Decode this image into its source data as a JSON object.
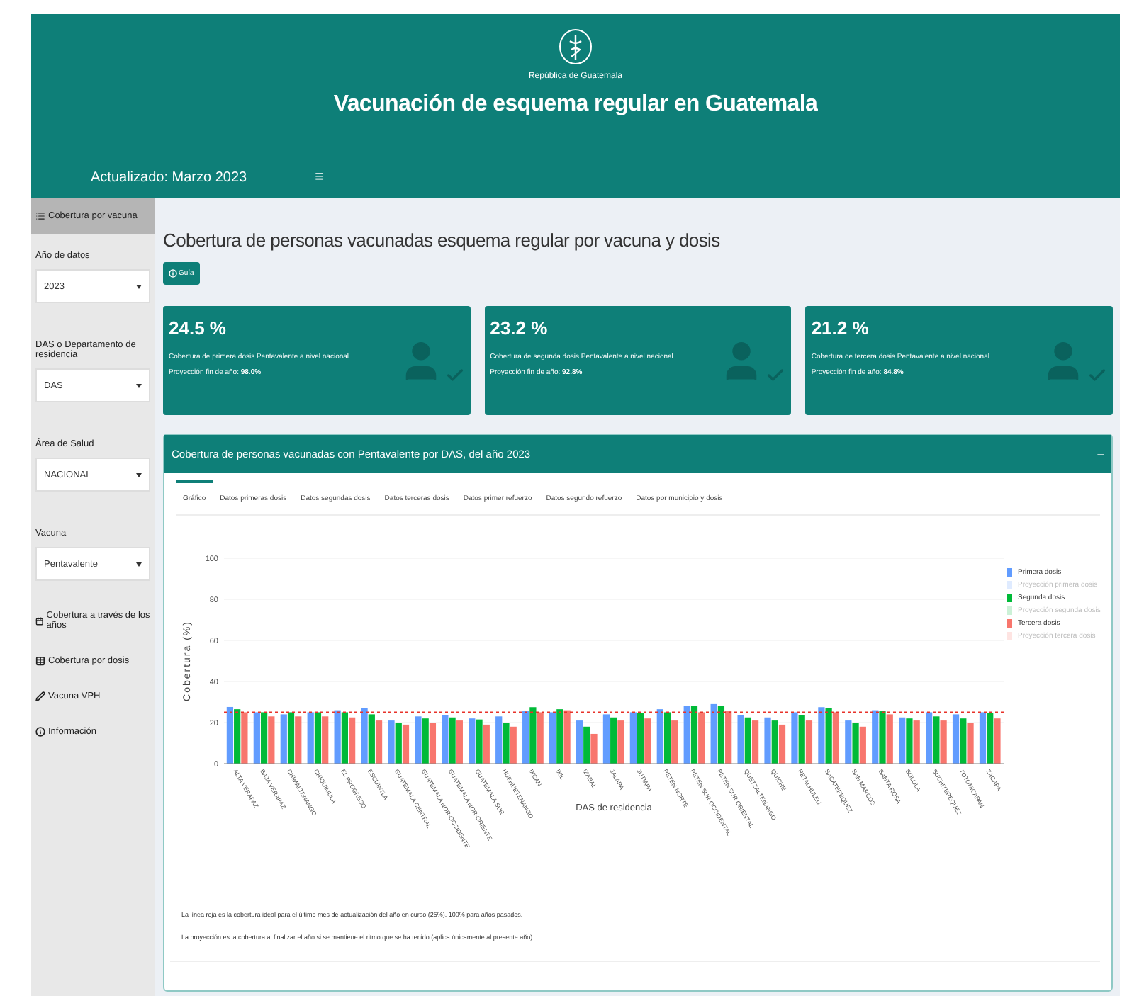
{
  "header": {
    "title": "Vacunación de esquema regular en Guatemala",
    "logo_caption": "República de Guatemala",
    "updated": "Actualizado: Marzo 2023",
    "menu_toggle": "≡"
  },
  "sidebar": {
    "items": [
      {
        "label": "Cobertura por vacuna",
        "selected": true
      }
    ],
    "filters": [
      {
        "label": "Año de datos",
        "value": "2023"
      },
      {
        "label": "DAS o Departamento de residencia",
        "value": "DAS"
      },
      {
        "label": "Área de Salud",
        "value": "NACIONAL"
      },
      {
        "label": "Vacuna",
        "value": "Pentavalente"
      }
    ],
    "links": [
      {
        "label": "Cobertura a través de los años",
        "selected": false
      },
      {
        "label": "Cobertura por dosis",
        "selected": false
      },
      {
        "label": "Vacuna VPH",
        "selected": false
      },
      {
        "label": "Información",
        "selected": false
      }
    ]
  },
  "main": {
    "title": "Cobertura de personas vacunadas esquema regular por vacuna y dosis",
    "guide_button": "Guía",
    "cards": [
      {
        "value": "24.5 %",
        "description": "Cobertura de primera dosis Pentavalente a nivel nacional",
        "projection": "Proyección fin de año: **98.0%**"
      },
      {
        "value": "23.2 %",
        "description": "Cobertura de segunda dosis Pentavalente a nivel nacional",
        "projection": "Proyección fin de año: **92.8%**"
      },
      {
        "value": "21.2 %",
        "description": "Cobertura de tercera dosis Pentavalente a nivel nacional",
        "projection": "Proyección fin de año: **84.8%**"
      }
    ],
    "panel": {
      "title": "Cobertura de personas vacunadas con Pentavalente por DAS, del año 2023",
      "collapse": "−",
      "tabs": [
        {
          "label": "Gráfico",
          "selected": true
        },
        {
          "label": "Datos primeras dosis",
          "selected": false
        },
        {
          "label": "Datos segundas dosis",
          "selected": false
        },
        {
          "label": "Datos terceras dosis",
          "selected": false
        },
        {
          "label": "Datos primer refuerzo",
          "selected": false
        },
        {
          "label": "Datos segundo refuerzo",
          "selected": false
        },
        {
          "label": "Datos por municipio y dosis",
          "selected": false
        }
      ],
      "chart_data": {
        "type": "bar",
        "xlabel": "DAS de residencia",
        "ylabel": "Cobertura (%)",
        "categories": [
          "ALTA VERAPAZ",
          "BAJA VERAPAZ",
          "CHIMALTENANGO",
          "CHIQUIMULA",
          "EL PROGRESO",
          "ESCUINTLA",
          "GUATEMALA CENTRAL",
          "GUATEMALA NOR-OCCIDENTE",
          "GUATEMALA NOR-ORIENTE",
          "GUATEMALA SUR",
          "HUEHUETENANGO",
          "IXCAN",
          "IXIL",
          "IZABAL",
          "JALAPA",
          "JUTIAPA",
          "PETEN NORTE",
          "PETEN SUR OCCIDENTAL",
          "PETEN SUR ORIENTAL",
          "QUETZALTENANGO",
          "QUICHE",
          "RETALHULEU",
          "SACATEPEQUEZ",
          "SAN MARCOS",
          "SANTA ROSA",
          "SOLOLA",
          "SUCHITEPEQUEZ",
          "TOTONICAPAN",
          "ZACAPA"
        ],
        "series": [
          {
            "name": "Primera dosis",
            "color": "#619cff",
            "values": [
              27.6,
              25,
              24,
              25,
              26,
              27,
              21,
              23,
              23.5,
              22,
              23,
              25.5,
              25,
              21,
              24,
              25,
              26.5,
              28,
              29,
              23.5,
              22.5,
              25,
              27.5,
              21,
              26,
              22.5,
              25,
              24,
              25
            ]
          },
          {
            "name": "Segunda dosis",
            "color": "#00ba38",
            "values": [
              26.5,
              25,
              25,
              25,
              25,
              24,
              20,
              22,
              22.5,
              21.5,
              20,
              27.5,
              26.5,
              18,
              22.5,
              24.5,
              25,
              28,
              28,
              22.5,
              21,
              23.5,
              27,
              20,
              25.5,
              22,
              23,
              22,
              24.5
            ]
          },
          {
            "name": "Tercera dosis",
            "color": "#f8766d",
            "values": [
              25,
              23,
              23,
              23,
              22.5,
              21,
              19,
              20,
              21,
              19,
              18,
              25,
              26,
              14.5,
              21,
              22,
              21,
              25,
              25.5,
              21,
              19,
              21,
              25,
              18,
              24,
              21,
              21,
              20,
              22
            ]
          }
        ],
        "ylim": [
          0,
          100
        ],
        "yticks": [
          0,
          20,
          40,
          60,
          80,
          100
        ],
        "grid": true,
        "ref_lines": [
          {
            "axis": "y",
            "value": 25
          }
        ]
      },
      "projection_legend": [
        {
          "label": "Proyección primera dosis",
          "hidden": true
        },
        {
          "label": "Proyección segunda dosis",
          "hidden": true
        },
        {
          "label": "Proyección tercera dosis",
          "hidden": true
        }
      ],
      "notes": [
        "La línea roja es la cobertura ideal para el último mes de actualización del año en curso (25%). 100% para años pasados.",
        "La proyección es la cobertura al finalizar el año si se mantiene el ritmo que se ha tenido (aplica únicamente al presente año)."
      ]
    }
  }
}
